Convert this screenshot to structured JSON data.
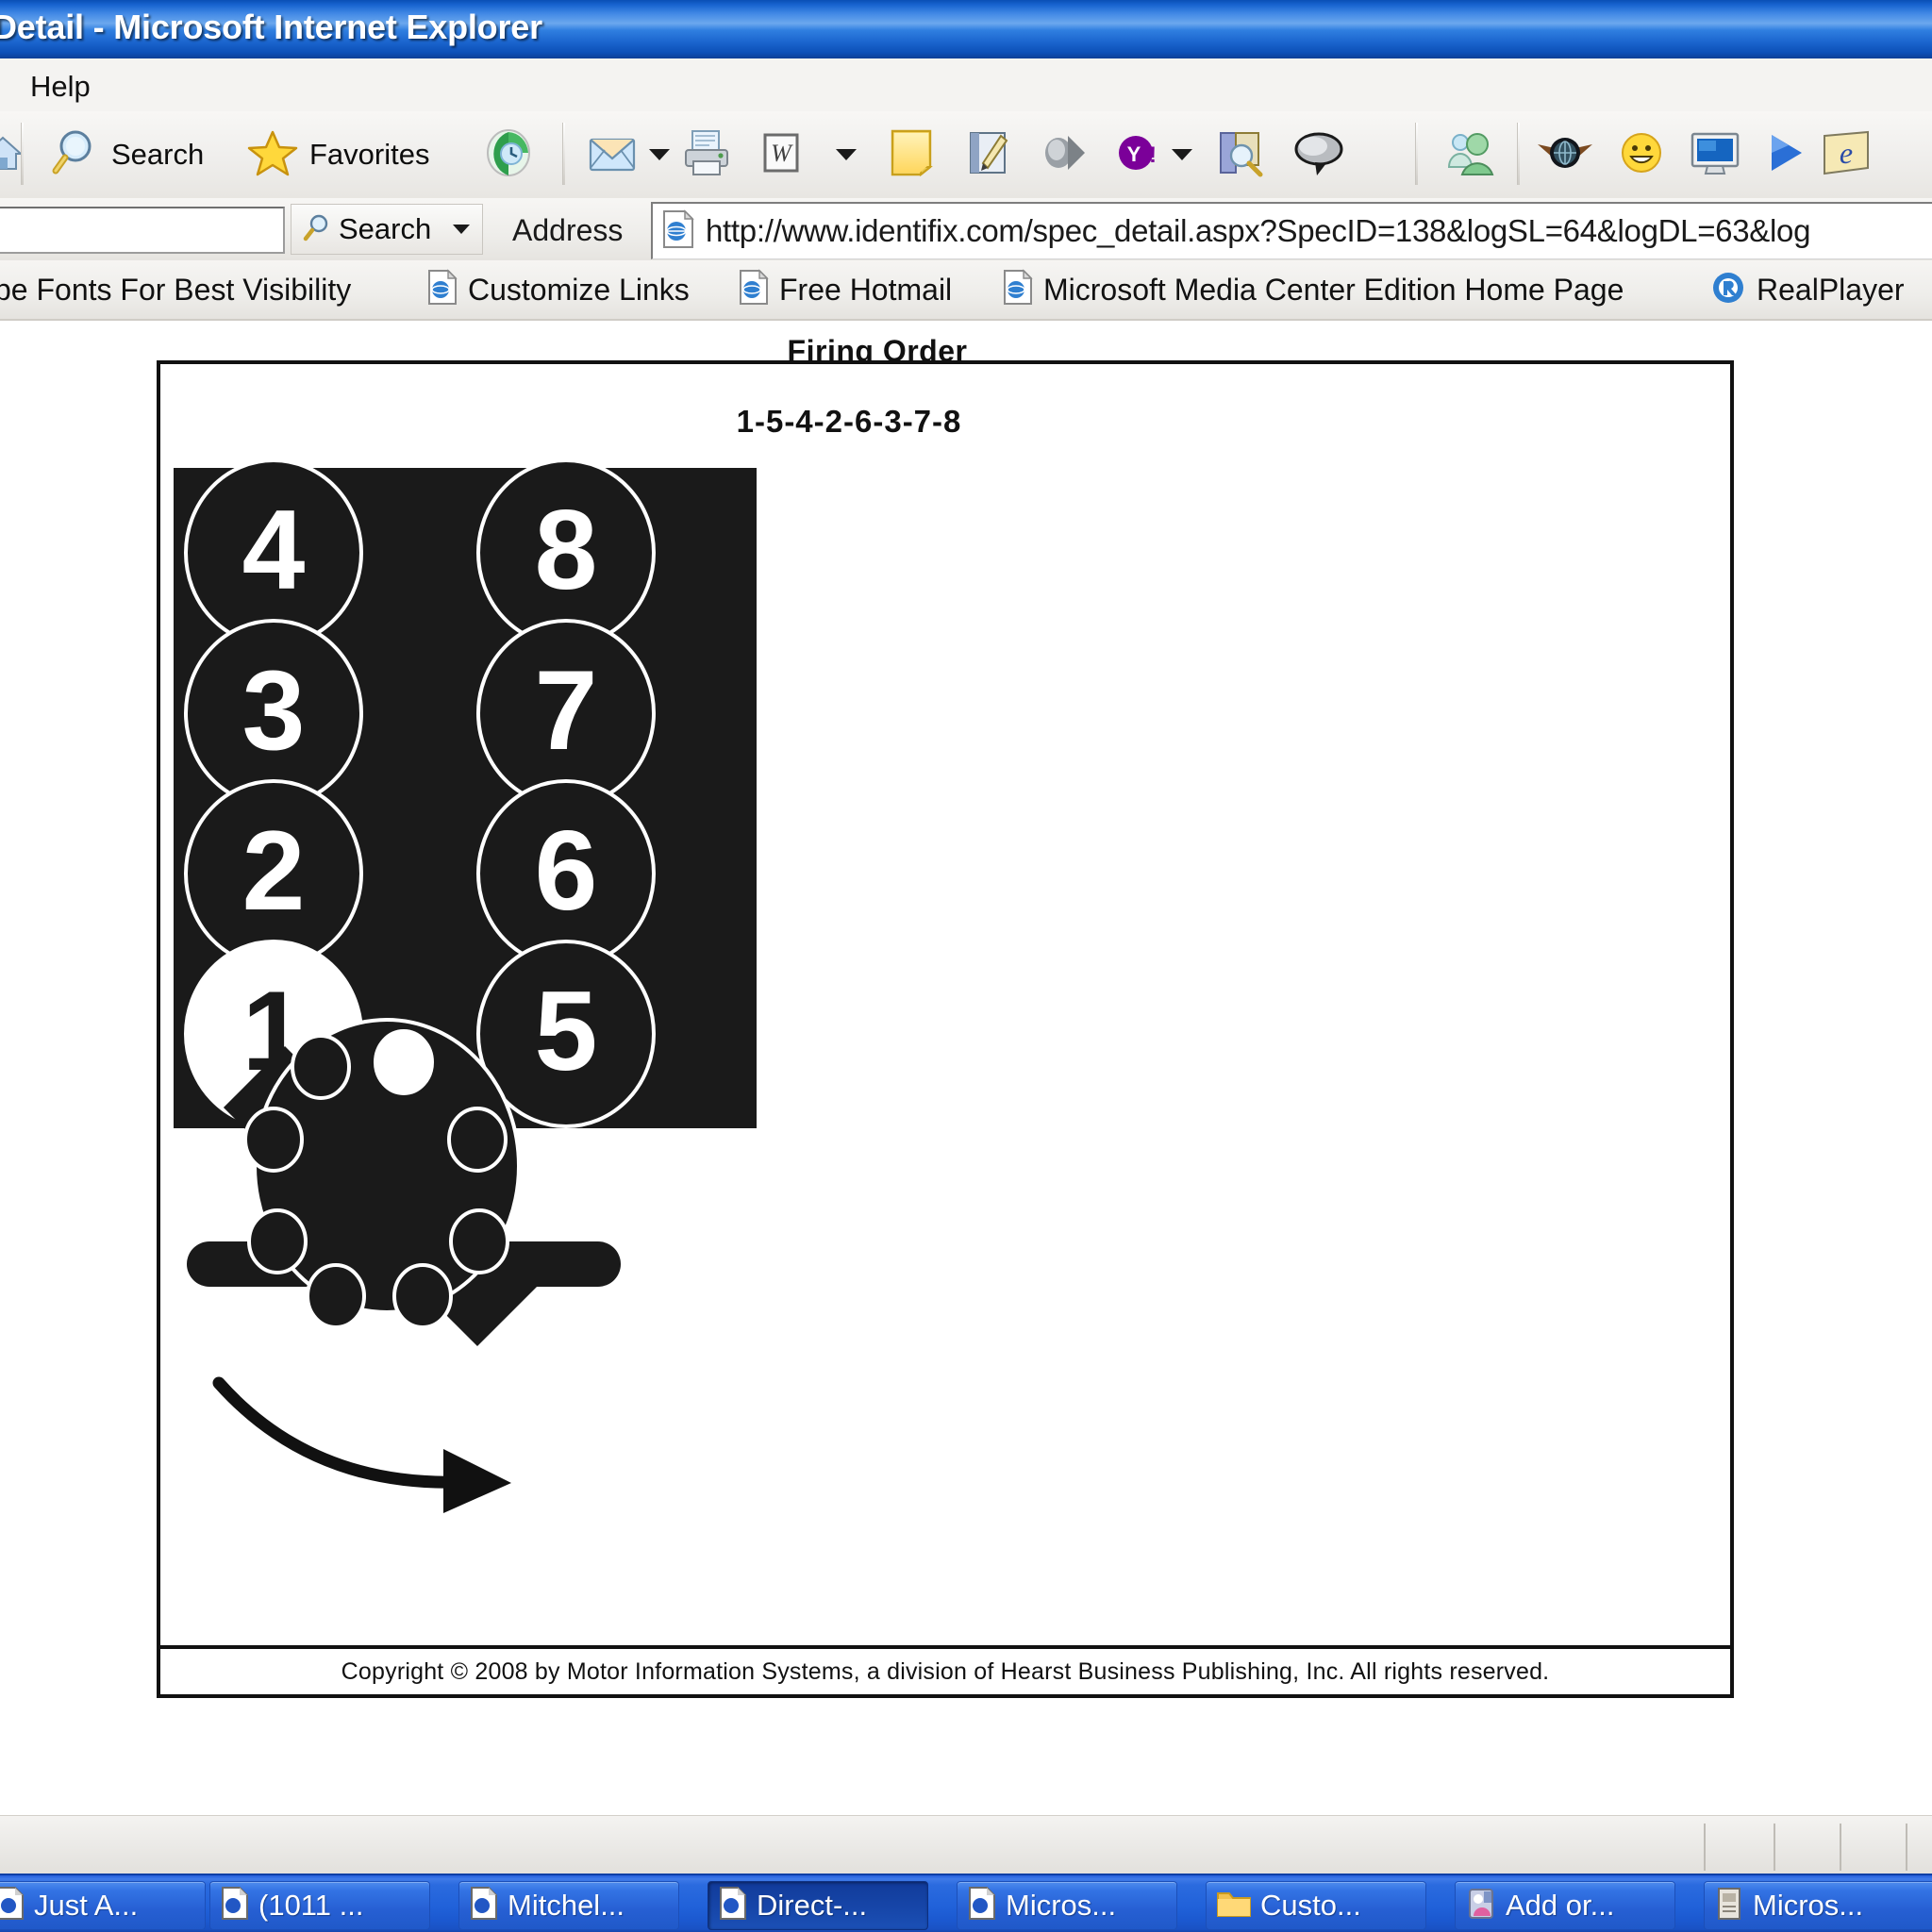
{
  "window": {
    "title": "Detail - Microsoft Internet Explorer"
  },
  "menu": {
    "items": [
      {
        "label": "Help"
      }
    ]
  },
  "toolbar": {
    "search_label": "Search",
    "favorites_label": "Favorites",
    "icons": [
      "home-icon",
      "search-icon",
      "favorites-star-icon",
      "history-icon",
      "mail-icon",
      "mail-dropdown-caret",
      "print-icon",
      "word-icon",
      "word-dropdown-caret",
      "notes-icon",
      "edit-icon",
      "media-play-icon",
      "yahoo-icon",
      "yahoo-dropdown-caret",
      "yahoo-search-tool-icon",
      "messenger-bubble-icon",
      "msn-contacts-icon",
      "winged-globe-icon",
      "smiley-icon",
      "monitor-icon",
      "blue-arrow-icon",
      "ie-logo-icon"
    ]
  },
  "address": {
    "go_search_label": "Search",
    "address_label": "Address",
    "url": "http://www.identifix.com/spec_detail.aspx?SpecID=138&logSL=64&logDL=63&log",
    "search_input_value": ""
  },
  "links": [
    {
      "label": "ype Fonts For Best Visibility",
      "icon": ""
    },
    {
      "label": "Customize Links",
      "icon": "ie-page-icon"
    },
    {
      "label": "Free Hotmail",
      "icon": "ie-page-icon"
    },
    {
      "label": "Microsoft Media Center Edition Home Page",
      "icon": "ie-page-icon"
    },
    {
      "label": "RealPlayer",
      "icon": "realplayer-icon"
    }
  ],
  "page": {
    "title": "Firing Order",
    "firing_sequence": "1-5-4-2-6-3-7-8",
    "copyright": "Copyright © 2008 by Motor Information Systems, a division of Hearst Business Publishing, Inc. All rights reserved."
  },
  "chart_data": {
    "type": "diagram",
    "title": "Firing Order",
    "firing_order": [
      1,
      5,
      4,
      2,
      6,
      3,
      7,
      8
    ],
    "engine_layout": "V8",
    "cylinder_bank_left": [
      4,
      3,
      2,
      1
    ],
    "cylinder_bank_right": [
      8,
      7,
      6,
      5
    ],
    "highlighted_cylinder": 1,
    "distributor": {
      "terminals": 8,
      "highlighted_terminal_index": 1,
      "rotation": "clockwise",
      "rotor_present": true
    },
    "colors": {
      "block_fill": "#1a1a1a",
      "circle_stroke": "#ffffff",
      "number_fill": "#ffffff",
      "highlight_fill": "#ffffff",
      "page_background": "#ffffff"
    }
  },
  "taskbar": {
    "buttons": [
      {
        "label": "Just A...",
        "icon": "ie-page-icon",
        "active": false
      },
      {
        "label": "(1011 ...",
        "icon": "ie-page-icon",
        "active": false
      },
      {
        "label": "Mitchel...",
        "icon": "ie-page-icon",
        "active": false
      },
      {
        "label": "Direct-...",
        "icon": "ie-page-icon",
        "active": true
      },
      {
        "label": "Micros...",
        "icon": "ie-page-icon",
        "active": false
      },
      {
        "label": "Custo...",
        "icon": "folder-icon",
        "active": false
      },
      {
        "label": "Add or...",
        "icon": "add-remove-programs-icon",
        "active": false
      },
      {
        "label": "Micros...",
        "icon": "document-icon",
        "active": false
      }
    ]
  }
}
